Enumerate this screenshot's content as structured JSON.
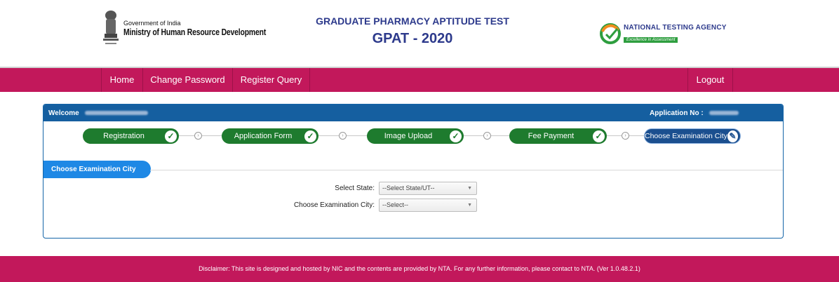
{
  "header": {
    "gov_small": "Government of India",
    "gov_ministry": "Ministry of Human Resource Development",
    "exam_subtitle": "GRADUATE PHARMACY APTITUDE TEST",
    "exam_title": "GPAT - 2020",
    "agency_name": "NATIONAL TESTING AGENCY",
    "agency_tagline": "Excellence in Assessment"
  },
  "nav": {
    "items": [
      {
        "label": "Home"
      },
      {
        "label": "Change Password"
      },
      {
        "label": "Register Query"
      }
    ],
    "logout_label": "Logout"
  },
  "panel": {
    "welcome_label": "Welcome",
    "application_no_label": "Application No :"
  },
  "steps": [
    {
      "label": "Registration",
      "status": "complete"
    },
    {
      "label": "Application Form",
      "status": "complete"
    },
    {
      "label": "Image Upload",
      "status": "complete"
    },
    {
      "label": "Fee Payment",
      "status": "complete"
    },
    {
      "label": "Choose Examination City",
      "status": "current"
    }
  ],
  "section": {
    "title": "Choose Examination City"
  },
  "form": {
    "state_label": "Select State:",
    "state_value": "--Select State/UT--",
    "city_label": "Choose Examination City:",
    "city_value": "--Select--"
  },
  "footer": {
    "disclaimer": "Disclaimer: This site is designed and hosted by NIC and the contents are provided by NTA. For any further information, please contact to NTA. (Ver 1.0.48.2.1)"
  },
  "colors": {
    "nav_bg": "#c2185b",
    "panel_header": "#155fa0",
    "step_complete": "#1e7b2e",
    "step_current": "#1b4f8f",
    "section_tab": "#1e88e5",
    "title_text": "#2d3a8c"
  }
}
